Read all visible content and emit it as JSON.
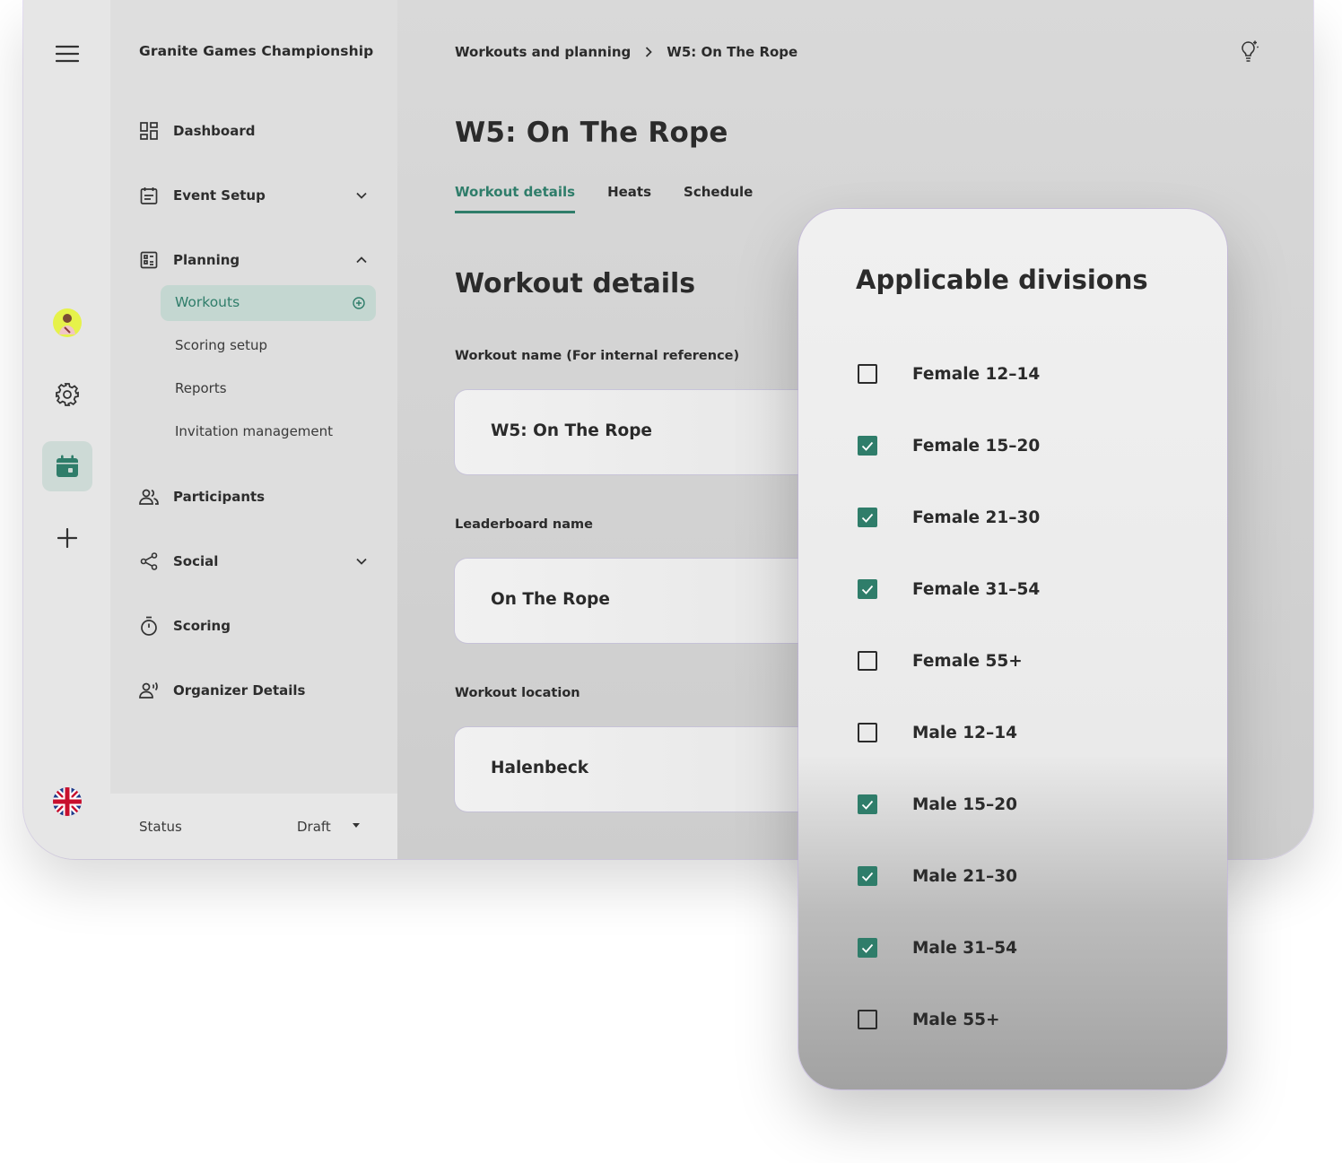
{
  "app": {
    "name": "Granite Games Championship"
  },
  "rail": {
    "menu_icon": "hamburger-icon",
    "avatar_icon": "avatar",
    "settings_icon": "gear-icon",
    "calendar_icon": "calendar-icon",
    "add_icon": "plus-icon",
    "language_icon": "uk-flag-icon"
  },
  "sidebar": {
    "items": [
      {
        "label": "Dashboard",
        "icon": "dashboard-icon"
      },
      {
        "label": "Event Setup",
        "icon": "calendar-list-icon",
        "expanded": false
      },
      {
        "label": "Planning",
        "icon": "planning-icon",
        "expanded": true
      },
      {
        "label": "Participants",
        "icon": "people-icon"
      },
      {
        "label": "Social",
        "icon": "share-icon",
        "expanded": false
      },
      {
        "label": "Scoring",
        "icon": "stopwatch-icon"
      },
      {
        "label": "Organizer Details",
        "icon": "organizer-icon"
      }
    ],
    "planning_sub": [
      {
        "label": "Workouts",
        "active": true
      },
      {
        "label": "Scoring setup"
      },
      {
        "label": "Reports"
      },
      {
        "label": "Invitation management"
      }
    ],
    "status_label": "Status",
    "status_value": "Draft"
  },
  "breadcrumb": {
    "parent": "Workouts and planning",
    "current": "W5: On The Rope"
  },
  "page": {
    "title": "W5: On The Rope",
    "tabs": [
      "Workout details",
      "Heats",
      "Schedule"
    ],
    "active_tab": "Workout details",
    "section_title": "Workout details",
    "fields": [
      {
        "label": "Workout name (For internal reference)",
        "value": "W5: On The Rope"
      },
      {
        "label": "Leaderboard name",
        "value": "On The Rope"
      },
      {
        "label": "Workout location",
        "value": "Halenbeck"
      }
    ]
  },
  "divisions": {
    "title": "Applicable divisions",
    "items": [
      {
        "label": "Female 12–14",
        "checked": false
      },
      {
        "label": "Female 15–20",
        "checked": true
      },
      {
        "label": "Female 21–30",
        "checked": true
      },
      {
        "label": "Female 31–54",
        "checked": true
      },
      {
        "label": "Female 55+",
        "checked": false
      },
      {
        "label": "Male 12–14",
        "checked": false
      },
      {
        "label": "Male 15–20",
        "checked": true
      },
      {
        "label": "Male 21–30",
        "checked": true
      },
      {
        "label": "Male 31–54",
        "checked": true
      },
      {
        "label": "Male 55+",
        "checked": false
      }
    ]
  },
  "colors": {
    "accent": "#2f7d6a",
    "accent_bg": "#c4d7d1",
    "text": "#2b2b2b"
  }
}
